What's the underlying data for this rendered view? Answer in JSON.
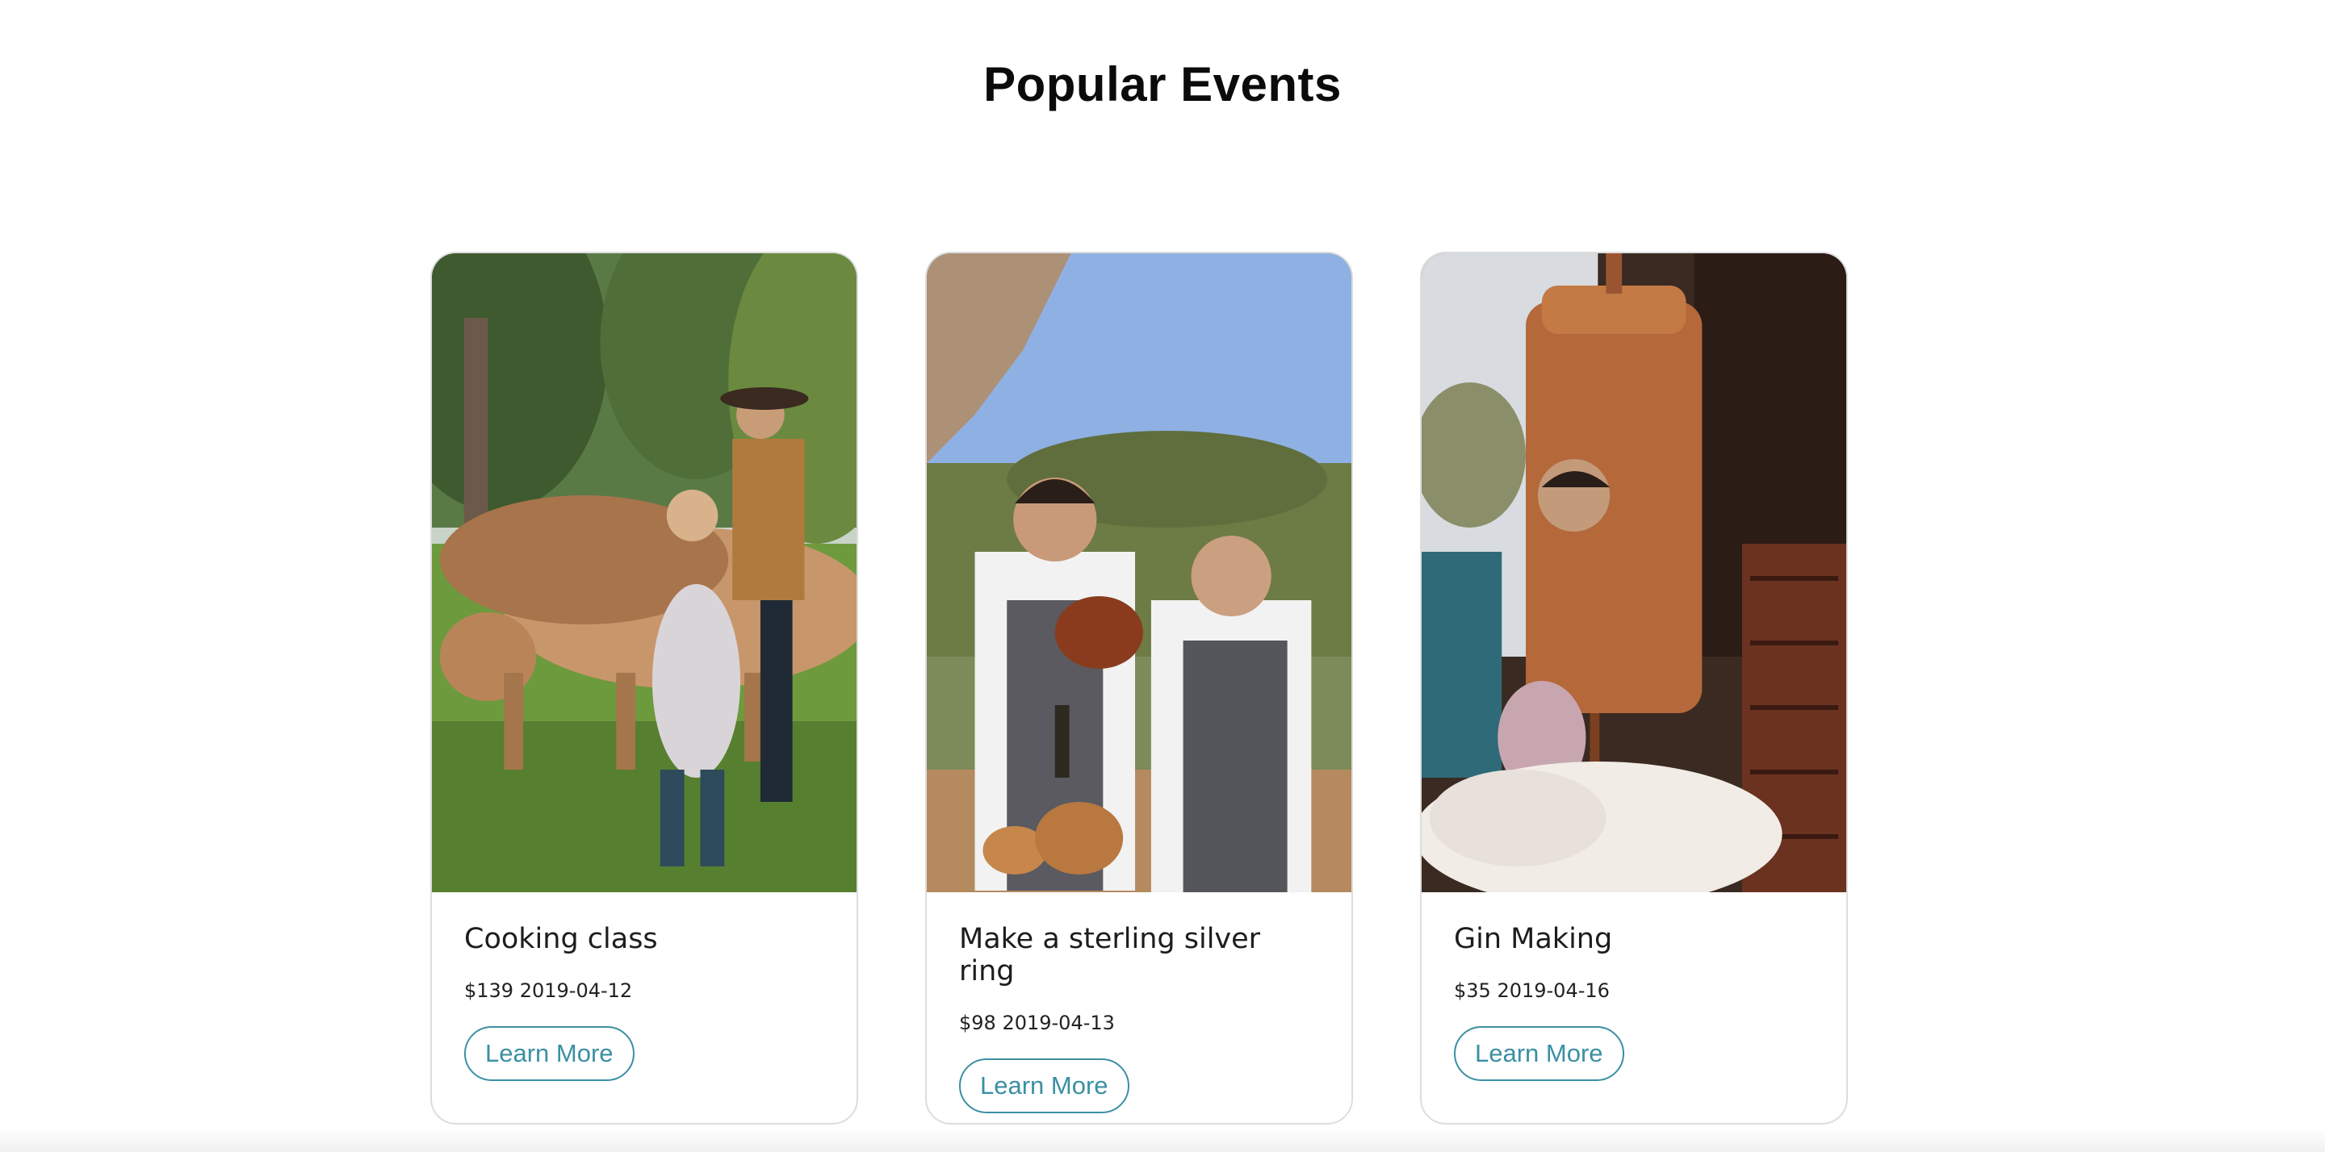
{
  "page": {
    "title": "Popular Events"
  },
  "events": [
    {
      "title": "Cooking class",
      "meta": "$139 2019-04-12",
      "button_label": "Learn More",
      "image_icon": "farm-cows-photo"
    },
    {
      "title": "Make a sterling silver ring",
      "meta": "$98 2019-04-13",
      "button_label": "Learn More",
      "image_icon": "two-chefs-photo"
    },
    {
      "title": "Gin Making",
      "meta": "$35 2019-04-16",
      "button_label": "Learn More",
      "image_icon": "copper-still-photo"
    }
  ],
  "colors": {
    "accent": "#3b8fa3",
    "card_border": "#dddddd"
  }
}
